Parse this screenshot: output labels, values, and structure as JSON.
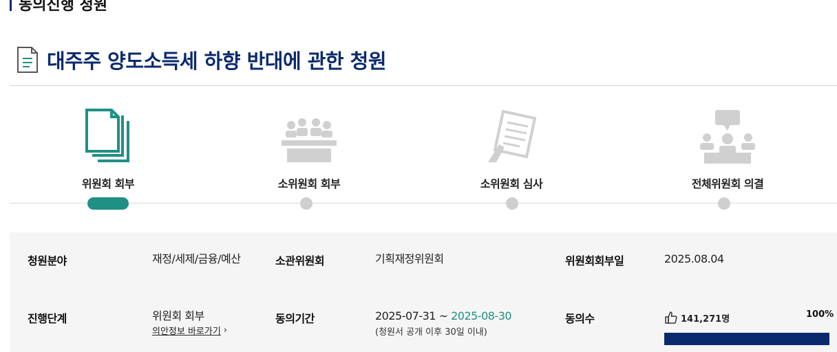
{
  "section": {
    "title": "동의진행 청원"
  },
  "petition": {
    "title": "대주주 양도소득세 하향 반대에 관한 청원"
  },
  "steps": [
    {
      "label": "위원회 회부",
      "icon": "documents-stack-icon",
      "active": true
    },
    {
      "label": "소위원회 회부",
      "icon": "committee-meeting-icon",
      "active": false
    },
    {
      "label": "소위원회 심사",
      "icon": "document-review-icon",
      "active": false
    },
    {
      "label": "전체위원회 의결",
      "icon": "plenary-vote-icon",
      "active": false
    }
  ],
  "info": {
    "field_label": "청원분야",
    "field_value": "재정/세제/금융/예산",
    "committee_label": "소관위원회",
    "committee_value": "기획재정위원회",
    "referral_date_label": "위원회회부일",
    "referral_date_value": "2025.08.04",
    "stage_label": "진행단계",
    "stage_value": "위원회 회부",
    "stage_link": "의안정보 바로가기",
    "period_label": "동의기간",
    "period_start": "2025-07-31",
    "period_separator": "~",
    "period_end": "2025-08-30",
    "period_note": "(청원서 공개 이후 30일 이내)",
    "agree_label": "동의수",
    "agree_count": "141,271명",
    "agree_percent_text": "100%",
    "agree_percent": 100
  },
  "colors": {
    "accent": "#1f9084",
    "navy": "#0b2a6e",
    "inactive": "#cfcfcf"
  }
}
